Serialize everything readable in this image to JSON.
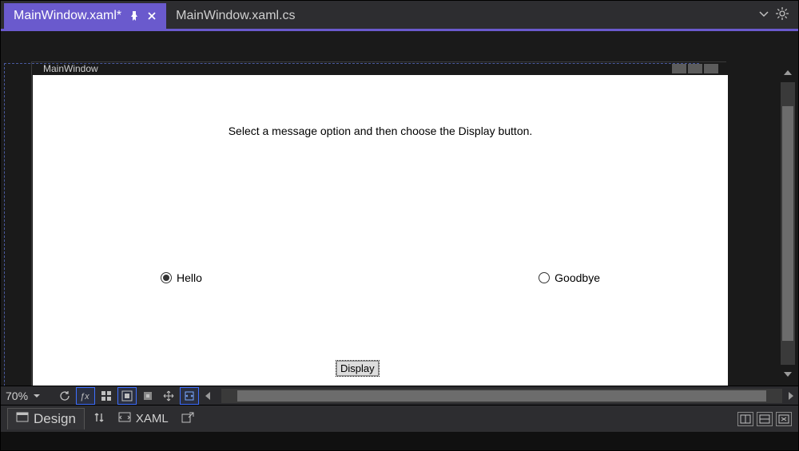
{
  "tabs": {
    "active_label": "MainWindow.xaml*",
    "inactive_label": "MainWindow.xaml.cs"
  },
  "designer": {
    "window_title": "MainWindow",
    "instruction_text": "Select a message option and then choose the Display button.",
    "radio_hello": "Hello",
    "radio_goodbye": "Goodbye",
    "display_button_label": "Display",
    "zoom_value": "70%"
  },
  "bottom_tabs": {
    "design_label": "Design",
    "xaml_label": "XAML"
  }
}
